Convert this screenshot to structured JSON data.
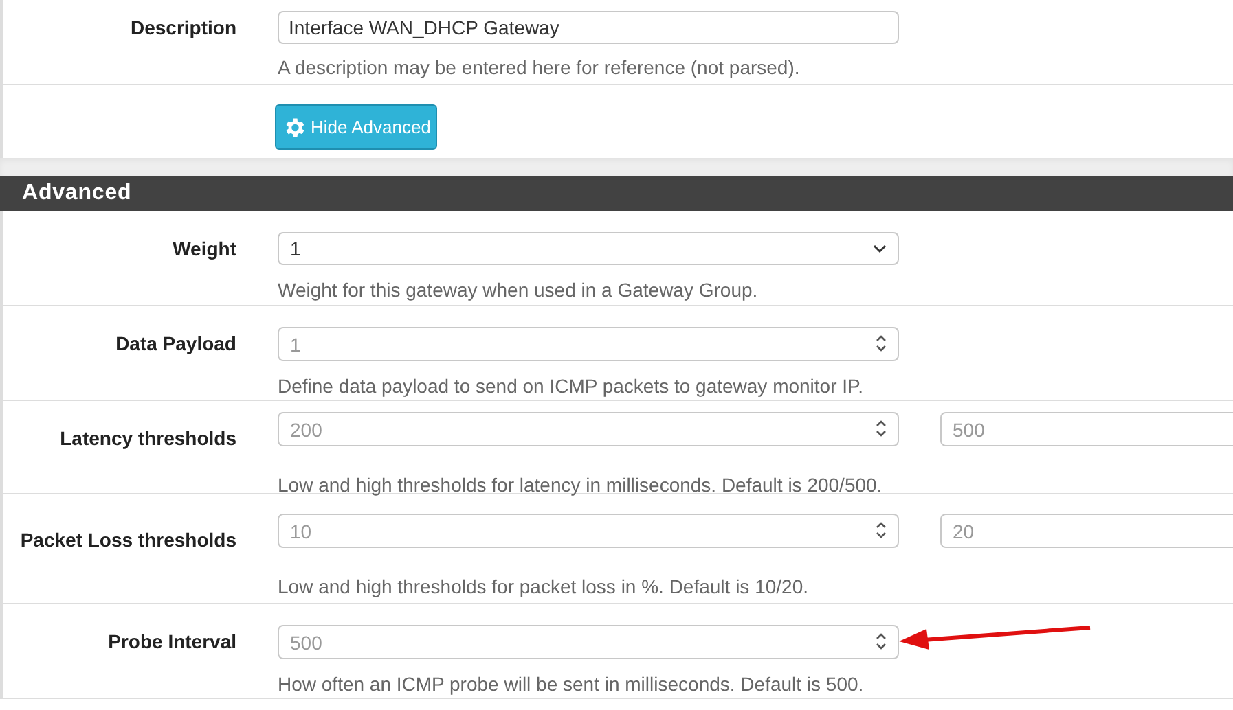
{
  "description": {
    "label": "Description",
    "value": "Interface WAN_DHCP Gateway",
    "help": "A description may be entered here for reference (not parsed)."
  },
  "toggle_button": {
    "label": "Hide Advanced"
  },
  "section": {
    "title": "Advanced"
  },
  "fields": [
    {
      "kind": "select",
      "label": "Weight",
      "value": "1",
      "help": "Weight for this gateway when used in a Gateway Group."
    },
    {
      "kind": "number",
      "label": "Data Payload",
      "placeholder": "1",
      "help": "Define data payload to send on ICMP packets to gateway monitor IP."
    },
    {
      "kind": "pair",
      "label": "Latency thresholds",
      "placeholders": [
        "200",
        "500"
      ],
      "help": "Low and high thresholds for latency in milliseconds. Default is 200/500."
    },
    {
      "kind": "pair",
      "label": "Packet Loss thresholds",
      "placeholders": [
        "10",
        "20"
      ],
      "help": "Low and high thresholds for packet loss in %. Default is 10/20."
    },
    {
      "kind": "number",
      "label": "Probe Interval",
      "placeholder": "500",
      "help": "How often an ICMP probe will be sent in milliseconds. Default is 500."
    }
  ]
}
